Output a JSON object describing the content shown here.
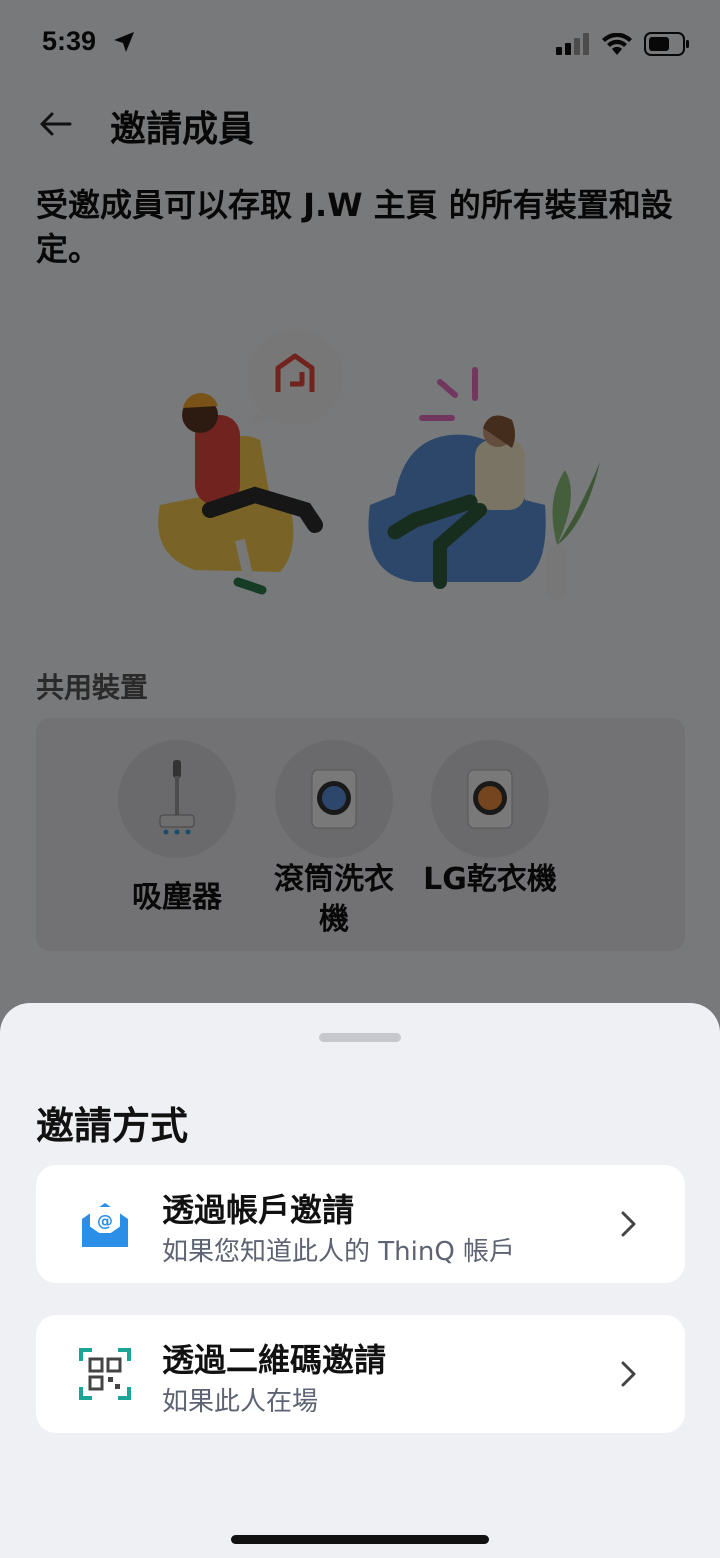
{
  "status": {
    "time": "5:39"
  },
  "nav": {
    "title": "邀請成員"
  },
  "intro": "受邀成員可以存取 J.W 主頁 的所有裝置和設定。",
  "shared": {
    "title": "共用裝置",
    "devices": [
      {
        "label": "吸塵器",
        "icon": "vacuum-icon"
      },
      {
        "label": "滾筒洗衣機",
        "icon": "washer-icon"
      },
      {
        "label": "LG乾衣機",
        "icon": "dryer-icon"
      }
    ]
  },
  "sheet": {
    "title": "邀請方式",
    "options": [
      {
        "title": "透過帳戶邀請",
        "subtitle": "如果您知道此人的 ThinQ 帳戶",
        "icon": "email-invite-icon"
      },
      {
        "title": "透過二維碼邀請",
        "subtitle": "如果此人在場",
        "icon": "qr-code-icon"
      }
    ]
  },
  "colors": {
    "accent_red": "#e0463f",
    "qr_teal": "#1aa597",
    "mail_blue": "#2b8fe8"
  }
}
